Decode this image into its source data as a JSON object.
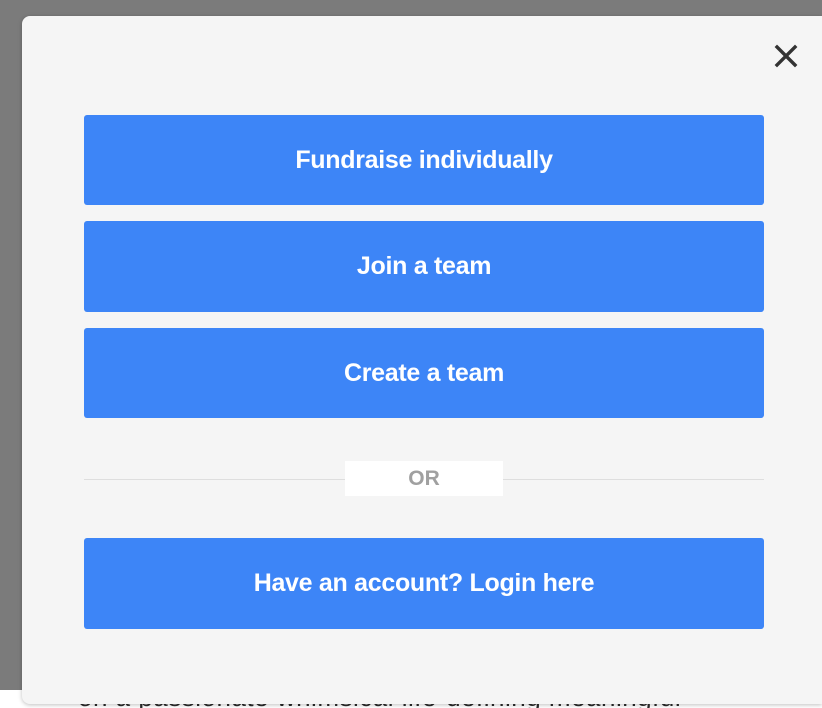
{
  "modal": {
    "close_icon": "close-icon",
    "buttons": {
      "fundraise_individually": "Fundraise individually",
      "join_team": "Join a team",
      "create_team": "Create a team",
      "login": "Have an account? Login here"
    },
    "divider_label": "OR"
  },
  "background": {
    "partial_text": "on a passionate whimsical life-defining meaningful"
  },
  "colors": {
    "button": "#3d85f7",
    "button_text": "#ffffff",
    "modal_bg": "#f5f5f5",
    "overlay": "#7b7b7b",
    "divider_text": "#a0a0a0"
  }
}
